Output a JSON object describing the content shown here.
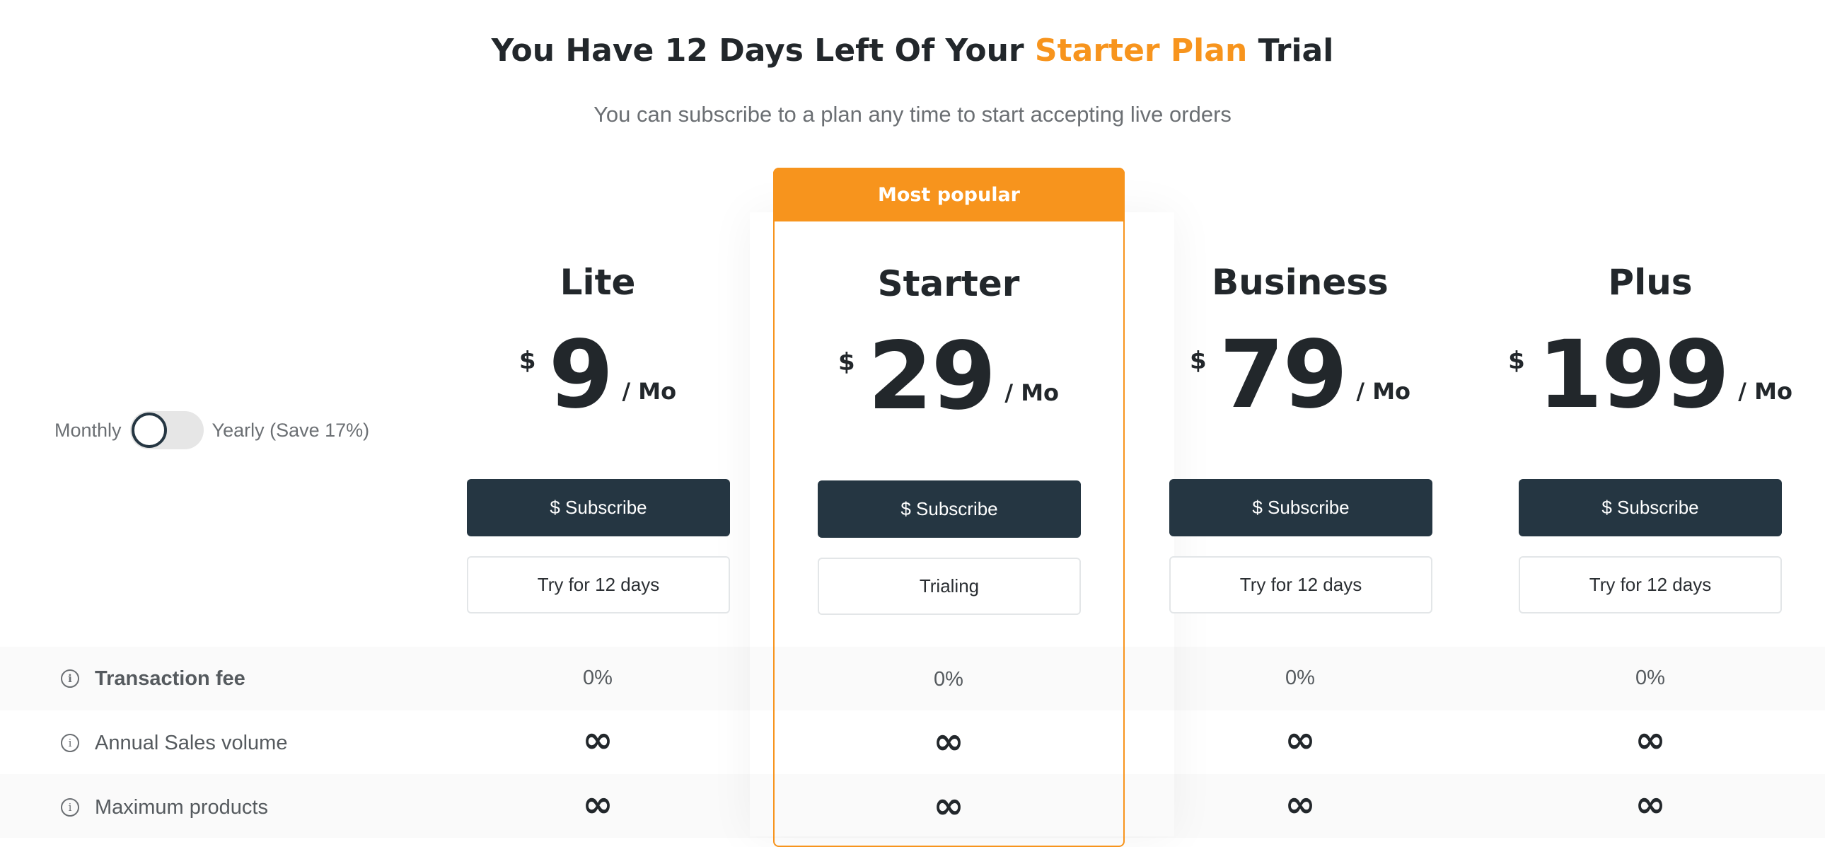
{
  "header": {
    "title_prefix": "You Have 12 Days Left Of Your ",
    "title_highlight": "Starter Plan",
    "title_suffix": " Trial",
    "subtitle": "You can subscribe to a plan any time to start accepting live orders"
  },
  "billing_toggle": {
    "left_label": "Monthly",
    "right_label": "Yearly (Save 17%)",
    "state": "Monthly"
  },
  "popular_badge": "Most popular",
  "plans": [
    {
      "name": "Lite",
      "currency": "$",
      "price": "9",
      "period": "/ Mo",
      "subscribe_label": "$ Subscribe",
      "trial_label": "Try for 12 days"
    },
    {
      "name": "Starter",
      "currency": "$",
      "price": "29",
      "period": "/ Mo",
      "subscribe_label": "$ Subscribe",
      "trial_label": "Trialing"
    },
    {
      "name": "Business",
      "currency": "$",
      "price": "79",
      "period": "/ Mo",
      "subscribe_label": "$ Subscribe",
      "trial_label": "Try for 12 days"
    },
    {
      "name": "Plus",
      "currency": "$",
      "price": "199",
      "period": "/ Mo",
      "subscribe_label": "$ Subscribe",
      "trial_label": "Try for 12 days"
    }
  ],
  "features": [
    {
      "label": "Transaction fee",
      "values": [
        "0%",
        "0%",
        "0%",
        "0%"
      ]
    },
    {
      "label": "Annual Sales volume",
      "values": [
        "∞",
        "∞",
        "∞",
        "∞"
      ]
    },
    {
      "label": "Maximum products",
      "values": [
        "∞",
        "∞",
        "∞",
        "∞"
      ]
    }
  ],
  "colors": {
    "accent": "#f7941d",
    "button_dark": "#253642",
    "text_dark": "#22272b"
  }
}
